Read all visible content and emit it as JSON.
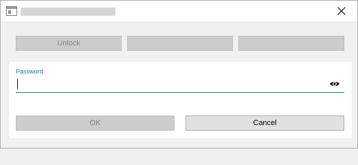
{
  "window": {
    "title": ""
  },
  "icons": {
    "app": "app-window-icon",
    "close": "close-icon",
    "show_password": "eye-icon"
  },
  "toolbar": {
    "buttons": [
      {
        "label": "Unlock",
        "enabled": false
      },
      {
        "label": "",
        "enabled": false
      },
      {
        "label": "",
        "enabled": false
      }
    ]
  },
  "password": {
    "label": "Password",
    "value": ""
  },
  "actions": {
    "ok_label": "OK",
    "cancel_label": "Cancel"
  },
  "colors": {
    "accent": "#0f7d8c",
    "disabled_button_bg": "#cccccc",
    "disabled_text": "#838383"
  }
}
